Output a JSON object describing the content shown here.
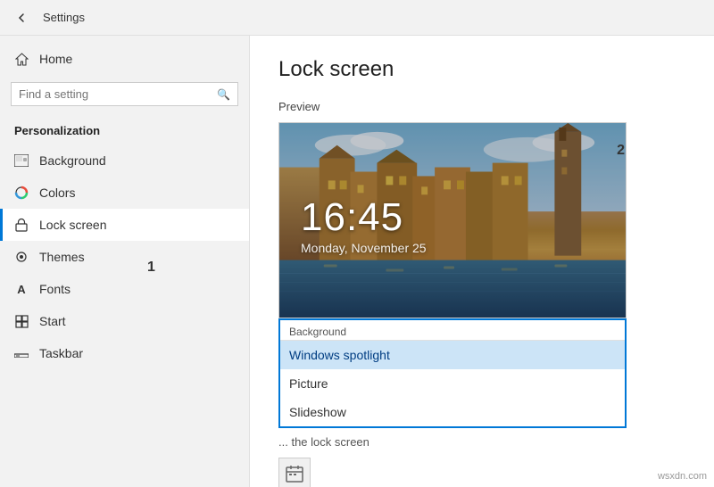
{
  "titleBar": {
    "title": "Settings",
    "backLabel": "←"
  },
  "sidebar": {
    "homeLabel": "Home",
    "searchPlaceholder": "Find a setting",
    "sectionTitle": "Personalization",
    "items": [
      {
        "id": "background",
        "label": "Background",
        "icon": "🖼"
      },
      {
        "id": "colors",
        "label": "Colors",
        "icon": "🎨"
      },
      {
        "id": "lock-screen",
        "label": "Lock screen",
        "icon": "🔒",
        "active": true
      },
      {
        "id": "themes",
        "label": "Themes",
        "icon": "🎭"
      },
      {
        "id": "fonts",
        "label": "Fonts",
        "icon": "A"
      },
      {
        "id": "start",
        "label": "Start",
        "icon": "⊞"
      },
      {
        "id": "taskbar",
        "label": "Taskbar",
        "icon": "▬"
      }
    ]
  },
  "content": {
    "pageTitle": "Lock screen",
    "previewLabel": "Preview",
    "clockTime": "16:45",
    "clockDate": "Monday, November 25",
    "dropdownLabel": "Background",
    "dropdownOptions": [
      {
        "id": "spotlight",
        "label": "Windows spotlight",
        "selected": true
      },
      {
        "id": "picture",
        "label": "Picture",
        "selected": false
      },
      {
        "id": "slideshow",
        "label": "Slideshow",
        "selected": false
      }
    ],
    "bottomText": "the lock screen",
    "badge1": "1",
    "badge2": "2"
  },
  "watermark": "wsxdn.com"
}
